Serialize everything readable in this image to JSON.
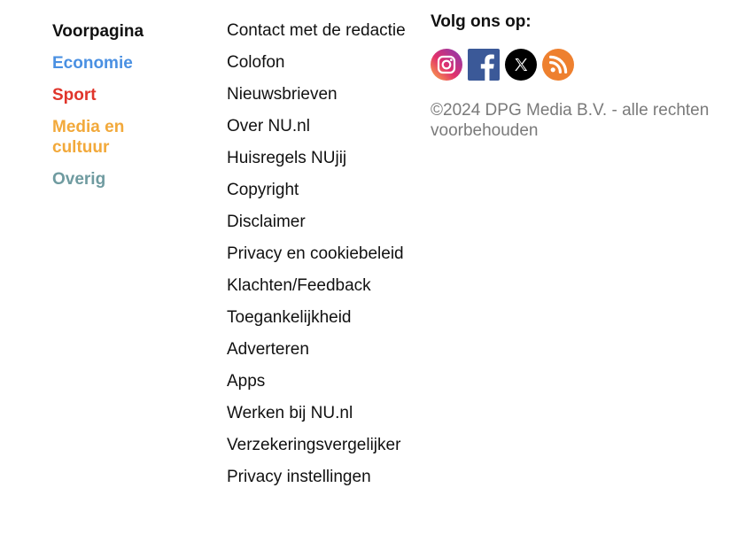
{
  "sections": [
    {
      "label": "Voorpagina",
      "color": "#111111"
    },
    {
      "label": "Economie",
      "color": "#4a90e2"
    },
    {
      "label": "Sport",
      "color": "#e0352b"
    },
    {
      "label": "Media en cultuur",
      "color": "#f2a93b"
    },
    {
      "label": "Overig",
      "color": "#6f9ba0"
    }
  ],
  "links": [
    "Contact met de redactie",
    "Colofon",
    "Nieuwsbrieven",
    "Over NU.nl",
    "Huisregels NUjij",
    "Copyright",
    "Disclaimer",
    "Privacy en cookiebeleid",
    "Klachten/Feedback",
    "Toegankelijkheid",
    "Adverteren",
    "Apps",
    "Werken bij NU.nl",
    "Verzekeringsvergelijker",
    "Privacy instellingen"
  ],
  "social": {
    "title": "Volg ons op:",
    "icons": [
      {
        "name": "instagram-icon",
        "color": "#c13584"
      },
      {
        "name": "facebook-icon",
        "color": "#3b5998"
      },
      {
        "name": "x-icon",
        "color": "#000000"
      },
      {
        "name": "rss-icon",
        "color": "#ee802f"
      }
    ]
  },
  "copyright": "©2024 DPG Media B.V. - alle rechten voorbehouden",
  "colors": {
    "copyright_text": "#7a7a7a"
  }
}
